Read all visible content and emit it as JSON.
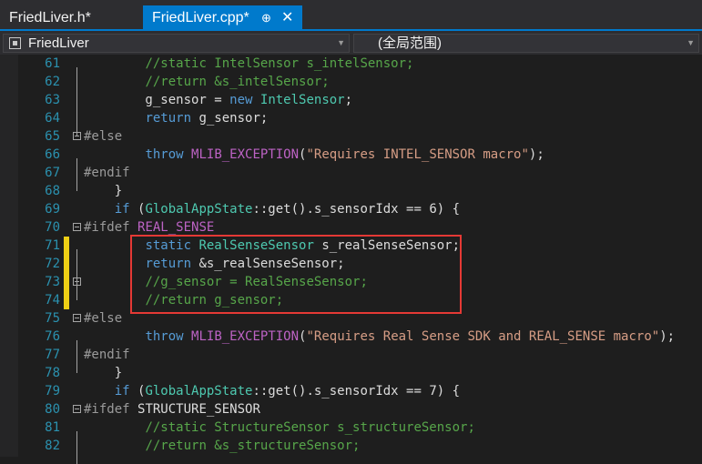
{
  "tabs": [
    {
      "label": "FriedLiver.h*",
      "active": false
    },
    {
      "label": "FriedLiver.cpp*",
      "active": true,
      "pin": "⊕",
      "close": "✕"
    }
  ],
  "navbar": {
    "project": "FriedLiver",
    "scope": "(全局范围)"
  },
  "colors": {
    "accent": "#007acc",
    "keyword": "#569cd6",
    "comment": "#57a64a",
    "type": "#4ec9b0",
    "string": "#d69d85",
    "line_number": "#2b91af",
    "change_marker": "#efcf15",
    "annotation_box": "#e53935"
  },
  "lines": [
    {
      "n": "61",
      "t": "        //static IntelSensor s_intelSensor;"
    },
    {
      "n": "62",
      "t": "        //return &s_intelSensor;"
    },
    {
      "n": "63",
      "t": "        g_sensor = new IntelSensor;"
    },
    {
      "n": "64",
      "t": "        return g_sensor;"
    },
    {
      "n": "65",
      "t": "#else"
    },
    {
      "n": "66",
      "t": "        throw MLIB_EXCEPTION(\"Requires INTEL_SENSOR macro\");"
    },
    {
      "n": "67",
      "t": "#endif"
    },
    {
      "n": "68",
      "t": "    }"
    },
    {
      "n": "69",
      "t": "    if (GlobalAppState::get().s_sensorIdx == 6) {"
    },
    {
      "n": "70",
      "t": "#ifdef REAL_SENSE"
    },
    {
      "n": "71",
      "t": "        static RealSenseSensor s_realSenseSensor;"
    },
    {
      "n": "72",
      "t": "        return &s_realSenseSensor;"
    },
    {
      "n": "73",
      "t": "        //g_sensor = RealSenseSensor;"
    },
    {
      "n": "74",
      "t": "        //return g_sensor;"
    },
    {
      "n": "75",
      "t": "#else"
    },
    {
      "n": "76",
      "t": "        throw MLIB_EXCEPTION(\"Requires Real Sense SDK and REAL_SENSE macro\");"
    },
    {
      "n": "77",
      "t": "#endif"
    },
    {
      "n": "78",
      "t": "    }"
    },
    {
      "n": "79",
      "t": "    if (GlobalAppState::get().s_sensorIdx == 7) {"
    },
    {
      "n": "80",
      "t": "#ifdef STRUCTURE_SENSOR"
    },
    {
      "n": "81",
      "t": "        //static StructureSensor s_structureSensor;"
    },
    {
      "n": "82",
      "t": "        //return &s_structureSensor;"
    }
  ]
}
